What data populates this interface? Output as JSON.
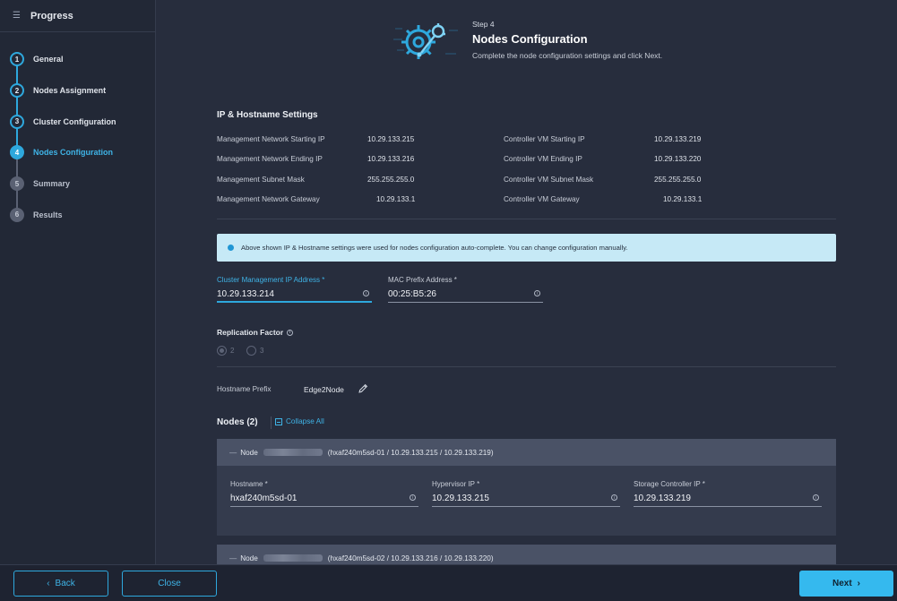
{
  "sidebar": {
    "title": "Progress",
    "title_icon": "progress-list-icon",
    "steps": [
      {
        "num": "1",
        "label": "General",
        "state": "done"
      },
      {
        "num": "2",
        "label": "Nodes Assignment",
        "state": "done"
      },
      {
        "num": "3",
        "label": "Cluster Configuration",
        "state": "done"
      },
      {
        "num": "4",
        "label": "Nodes Configuration",
        "state": "active"
      },
      {
        "num": "5",
        "label": "Summary",
        "state": "future"
      },
      {
        "num": "6",
        "label": "Results",
        "state": "future"
      }
    ]
  },
  "header": {
    "icon": "gear-wrench-icon",
    "kicker": "Step 4",
    "title": "Nodes Configuration",
    "description": "Complete the node configuration settings and click Next."
  },
  "ip_settings": {
    "title": "IP & Hostname Settings",
    "left": [
      {
        "label": "Management Network Starting IP",
        "value": "10.29.133.215"
      },
      {
        "label": "Management Network Ending IP",
        "value": "10.29.133.216"
      },
      {
        "label": "Management Subnet Mask",
        "value": "255.255.255.0"
      },
      {
        "label": "Management Network Gateway",
        "value": "10.29.133.1"
      }
    ],
    "right": [
      {
        "label": "Controller VM Starting IP",
        "value": "10.29.133.219"
      },
      {
        "label": "Controller VM Ending IP",
        "value": "10.29.133.220"
      },
      {
        "label": "Controller VM Subnet Mask",
        "value": "255.255.255.0"
      },
      {
        "label": "Controller VM Gateway",
        "value": "10.29.133.1"
      }
    ]
  },
  "banner": {
    "text": "Above shown IP & Hostname settings were used for nodes configuration auto-complete. You can change configuration manually."
  },
  "cluster_fields": {
    "cluster_ip": {
      "label": "Cluster Management IP Address *",
      "value": "10.29.133.214"
    },
    "mac_prefix": {
      "label": "MAC Prefix Address *",
      "value": "00:25:B5:26"
    }
  },
  "replication": {
    "label": "Replication Factor",
    "options": [
      "2",
      "3"
    ],
    "selected": "2"
  },
  "hostname_prefix": {
    "label": "Hostname Prefix",
    "value": "Edge2Node"
  },
  "nodes": {
    "title": "Nodes (2)",
    "collapse_label": "Collapse All",
    "items": [
      {
        "prefix": "Node",
        "detail": "(hxaf240m5sd-01 / 10.29.133.215 / 10.29.133.219)",
        "fields": [
          {
            "label": "Hostname *",
            "value": "hxaf240m5sd-01"
          },
          {
            "label": "Hypervisor IP *",
            "value": "10.29.133.215"
          },
          {
            "label": "Storage Controller IP *",
            "value": "10.29.133.219"
          }
        ]
      },
      {
        "prefix": "Node",
        "detail": "(hxaf240m5sd-02 / 10.29.133.216 / 10.29.133.220)"
      }
    ]
  },
  "footer": {
    "back": "Back",
    "close": "Close",
    "next": "Next"
  },
  "colors": {
    "accent": "#2ea8dd",
    "background": "#272d3d",
    "banner": "#c6e9f6"
  }
}
